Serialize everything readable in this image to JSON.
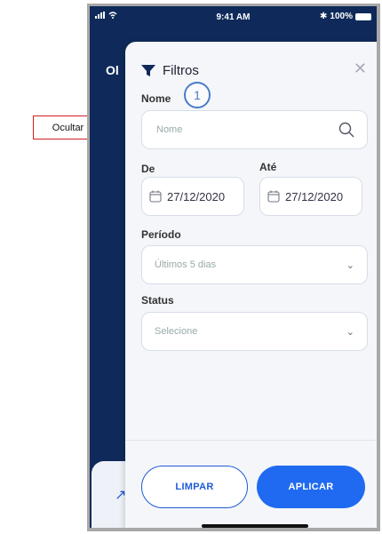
{
  "annotation": {
    "label": "Ocultar"
  },
  "statusbar": {
    "time": "9:41 AM",
    "battery": "100%"
  },
  "background": {
    "greeting": "Ol"
  },
  "drawer": {
    "title": "Filtros",
    "step_number": "1",
    "nome": {
      "label": "Nome",
      "placeholder": "Nome"
    },
    "de": {
      "label": "De",
      "value": "27/12/2020"
    },
    "ate": {
      "label": "Até",
      "value": "27/12/2020"
    },
    "periodo": {
      "label": "Período",
      "value": "Últimos 5 dias"
    },
    "status": {
      "label": "Status",
      "value": "Selecione"
    },
    "buttons": {
      "clear": "LIMPAR",
      "apply": "APLICAR"
    }
  },
  "colors": {
    "primary": "#1f6af0",
    "annotation": "#d41f1f",
    "background": "#0f2a5a"
  }
}
